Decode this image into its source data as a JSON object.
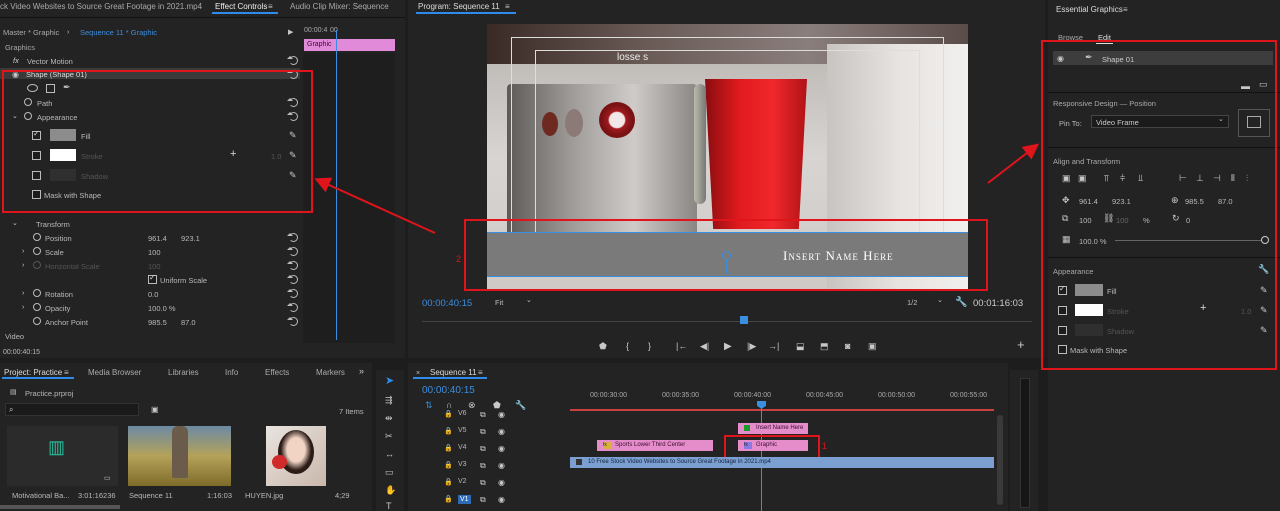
{
  "effect_controls": {
    "tab_source": "ck Video Websites to Source Great Footage in 2021.mp4",
    "tab_effect": "Effect Controls",
    "tab_mixer": "Audio Clip Mixer: Sequence",
    "master": "Master * Graphic",
    "sequence": "Sequence 11 * Graphic",
    "timecode_head": "00:00:4",
    "timecode_head2": "00",
    "clip_label": "Graphic",
    "section": "Graphics",
    "fx_label": "fx",
    "vector_motion": "Vector Motion",
    "shape": "Shape (Shape 01)",
    "path": "Path",
    "appearance": "Appearance",
    "fill": "Fill",
    "stroke": "Stroke",
    "stroke_width": "1.0",
    "shadow": "Shadow",
    "mask": "Mask with Shape",
    "transform": "Transform",
    "position": "Position",
    "pos_x": "961.4",
    "pos_y": "923.1",
    "scale": "Scale",
    "scale_val": "100",
    "hscale": "Horizontal Scale",
    "hscale_val": "100",
    "uniform": "Uniform Scale",
    "rotation": "Rotation",
    "rotation_val": "0.0",
    "opacity": "Opacity",
    "opacity_val": "100.0 %",
    "anchor": "Anchor Point",
    "anchor_x": "985.5",
    "anchor_y": "87.0",
    "video": "Video",
    "bottom_time": "00:00:40:15"
  },
  "program": {
    "title": "Program: Sequence 11",
    "timecode": "00:00:40:15",
    "fit": "Fit",
    "res": "1/2",
    "duration": "00:01:16:03",
    "lower_third_text": "Insert Name Here",
    "frame_text": "losse s"
  },
  "essential_graphics": {
    "title": "Essential Graphics",
    "tab_browse": "Browse",
    "tab_edit": "Edit",
    "layer": "Shape 01",
    "responsive": "Responsive Design — Position",
    "pin_to": "Pin To:",
    "pin_value": "Video Frame",
    "align": "Align and Transform",
    "pos_x": "961.4",
    "pos_y": "923.1",
    "anchor_x": "985.5",
    "anchor_y": "87.0",
    "scale": "100",
    "scale2": "100",
    "percent": "%",
    "rotation": "0",
    "opacity": "100.0 %",
    "appearance": "Appearance",
    "fill": "Fill",
    "stroke": "Stroke",
    "stroke_width": "1.0",
    "shadow": "Shadow",
    "mask": "Mask with Shape"
  },
  "project": {
    "tab_project": "Project: Practice",
    "tab_media": "Media Browser",
    "tab_libraries": "Libraries",
    "tab_info": "Info",
    "tab_effects": "Effects",
    "tab_markers": "Markers",
    "file": "Practice.prproj",
    "items_count": "7 Items",
    "thumbs": [
      {
        "name": "Motivational Ba...",
        "dur": "3:01:16236"
      },
      {
        "name": "Sequence 11",
        "dur": "1:16:03"
      },
      {
        "name": "HUYEN.jpg",
        "dur": "4;29"
      }
    ]
  },
  "timeline": {
    "title": "Sequence 11",
    "timecode": "00:00:40:15",
    "ruler": [
      "00:00:30:00",
      "00:00:35:00",
      "00:00:40:00",
      "00:00:45:00",
      "00:00:50:00",
      "00:00:55:00"
    ],
    "tracks": [
      "V6",
      "V5",
      "V4",
      "V3",
      "V2",
      "V1"
    ],
    "clip_insert": "Insert Name Here",
    "clip_sports": "Sports Lower Third Center",
    "clip_graphic": "Graphic",
    "clip_video": "10 Free Stock Video Websites to Source Great Footage in 2021.mp4"
  },
  "annotations": {
    "n1": "1",
    "n2": "2"
  },
  "colors": {
    "accent": "#3b8fe0",
    "annotation": "#e0141b",
    "clip_pink": "#e58ccb",
    "clip_blue": "#7b9fd1"
  }
}
